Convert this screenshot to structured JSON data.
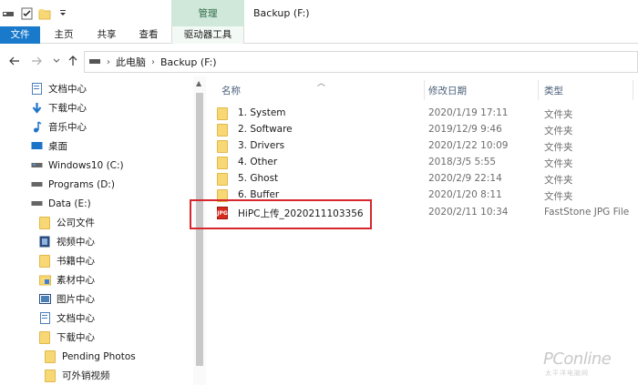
{
  "window": {
    "title": "Backup (F:)",
    "context_tab": "管理"
  },
  "ribbon": {
    "tabs": [
      "文件",
      "主页",
      "共享",
      "查看",
      "驱动器工具"
    ]
  },
  "address": {
    "crumbs": [
      "此电脑",
      "Backup (F:)"
    ]
  },
  "nav_pane": {
    "items": [
      {
        "label": "文档中心",
        "icon": "document-icon"
      },
      {
        "label": "下载中心",
        "icon": "download-arrow-icon"
      },
      {
        "label": "音乐中心",
        "icon": "music-note-icon"
      },
      {
        "label": "桌面",
        "icon": "desktop-icon"
      },
      {
        "label": "Windows10 (C:)",
        "icon": "drive-icon"
      },
      {
        "label": "Programs (D:)",
        "icon": "drive-icon"
      },
      {
        "label": "Data (E:)",
        "icon": "drive-icon"
      },
      {
        "label": "公司文件",
        "icon": "folder-icon"
      },
      {
        "label": "视频中心",
        "icon": "video-icon"
      },
      {
        "label": "书籍中心",
        "icon": "folder-icon"
      },
      {
        "label": "素材中心",
        "icon": "folder-image-icon"
      },
      {
        "label": "图片中心",
        "icon": "picture-icon"
      },
      {
        "label": "文档中心",
        "icon": "document-icon"
      },
      {
        "label": "下载中心",
        "icon": "folder-icon"
      },
      {
        "label": "Pending Photos",
        "icon": "folder-icon"
      },
      {
        "label": "可外销视频",
        "icon": "folder-icon"
      }
    ]
  },
  "file_list": {
    "headers": {
      "name": "名称",
      "date": "修改日期",
      "type": "类型"
    },
    "rows": [
      {
        "name": "1. System",
        "date": "2020/1/19 17:11",
        "type": "文件夹",
        "icon": "folder-icon"
      },
      {
        "name": "2. Software",
        "date": "2019/12/9 9:46",
        "type": "文件夹",
        "icon": "folder-icon"
      },
      {
        "name": "3. Drivers",
        "date": "2020/1/22 10:09",
        "type": "文件夹",
        "icon": "folder-icon"
      },
      {
        "name": "4. Other",
        "date": "2018/3/5 5:55",
        "type": "文件夹",
        "icon": "folder-icon"
      },
      {
        "name": "5. Ghost",
        "date": "2020/2/9 22:14",
        "type": "文件夹",
        "icon": "folder-icon"
      },
      {
        "name": "6. Buffer",
        "date": "2020/1/20 8:11",
        "type": "文件夹",
        "icon": "folder-icon"
      },
      {
        "name": "HiPC上传_2020211103356",
        "date": "2020/2/11 10:34",
        "type": "FastStone JPG File",
        "icon": "jpg-file-icon"
      }
    ]
  },
  "watermark": {
    "brand": "PConline",
    "sub": "太平洋电脑网"
  },
  "colors": {
    "accent": "#1979ca",
    "highlight": "#d7262d",
    "folder": "#f8d775",
    "context_tab": "#cfe8d9"
  }
}
